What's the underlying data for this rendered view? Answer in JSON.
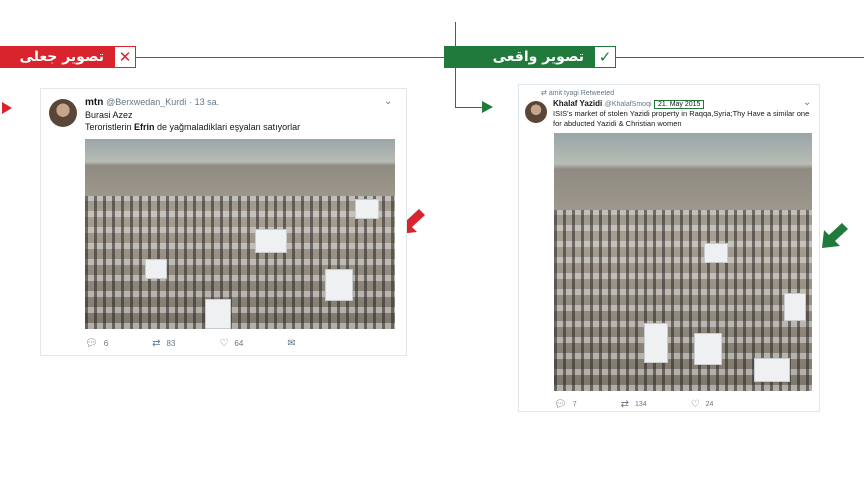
{
  "labels": {
    "fake": {
      "text": "تصویر جعلی",
      "mark": "✕",
      "color": "#d9232d"
    },
    "real": {
      "text": "تصویر واقعی",
      "mark": "✓",
      "color": "#1f7a3c"
    }
  },
  "fake_tweet": {
    "name": "mtn",
    "handle": "@Berxwedan_Kurdi",
    "time": "· 13 sa.",
    "line1": "Burasi Azez",
    "line2_pre": "Teroristlerin ",
    "line2_bold": "Efrin",
    "line2_post": " de yağmaladiklari eşyalan satıyorlar",
    "replies": "6",
    "retweets": "83",
    "likes": "64"
  },
  "real_tweet": {
    "retweeted_by": "amit tyagi Retweeted",
    "name": "Khalaf Yazidi",
    "handle": "@KhalafSmoqi",
    "date": "21. May 2015",
    "text": "ISIS's market of stolen Yazidi property in Raqqa,Syria;Thy Have a similar one for abducted Yazidi & Christian women",
    "replies": "7",
    "retweets": "134",
    "likes": "24"
  }
}
